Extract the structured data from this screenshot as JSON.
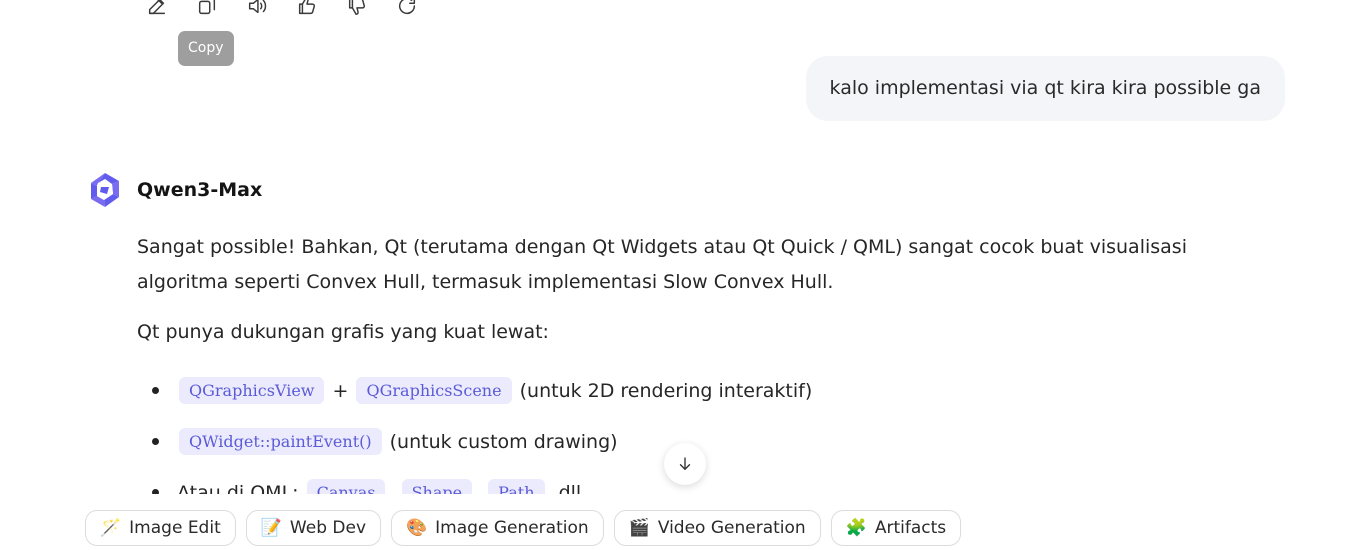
{
  "toolbar": {
    "icons": [
      "edit-icon",
      "copy-icon",
      "read-aloud-icon",
      "thumbs-up-icon",
      "thumbs-down-icon",
      "regenerate-icon"
    ],
    "tooltip": "Copy"
  },
  "user_message": "kalo implementasi via qt kira kira possible ga",
  "model": {
    "name": "Qwen3-Max",
    "logo_color": "#615ced"
  },
  "answer": {
    "para1": "Sangat possible! Bahkan, Qt (terutama dengan Qt Widgets atau Qt Quick / QML) sangat cocok buat visualisasi algoritma seperti Convex Hull, termasuk implementasi Slow Convex Hull.",
    "para2": "Qt punya dukungan grafis yang kuat lewat:",
    "bullet1": {
      "code1": "QGraphicsView",
      "sep": " + ",
      "code2": "QGraphicsScene",
      "tail": " (untuk 2D rendering interaktif)"
    },
    "bullet2": {
      "code1": "QWidget::paintEvent()",
      "tail": " (untuk custom drawing)"
    },
    "bullet3": {
      "lead": "Atau di QML: ",
      "code1": "Canvas",
      "sep1": ", ",
      "code2": "Shape",
      "sep2": ", ",
      "code3": "Path",
      "tail": ", dll."
    }
  },
  "chips": [
    {
      "icon": "🪄",
      "label": "Image Edit"
    },
    {
      "icon": "📝",
      "label": "Web Dev"
    },
    {
      "icon": "🎨",
      "label": "Image Generation"
    },
    {
      "icon": "🎬",
      "label": "Video Generation"
    },
    {
      "icon": "🧩",
      "label": "Artifacts"
    }
  ],
  "colors": {
    "code_text": "#5b5bd6",
    "code_bg": "#ecebfd",
    "bubble_bg": "#f4f5f9"
  }
}
